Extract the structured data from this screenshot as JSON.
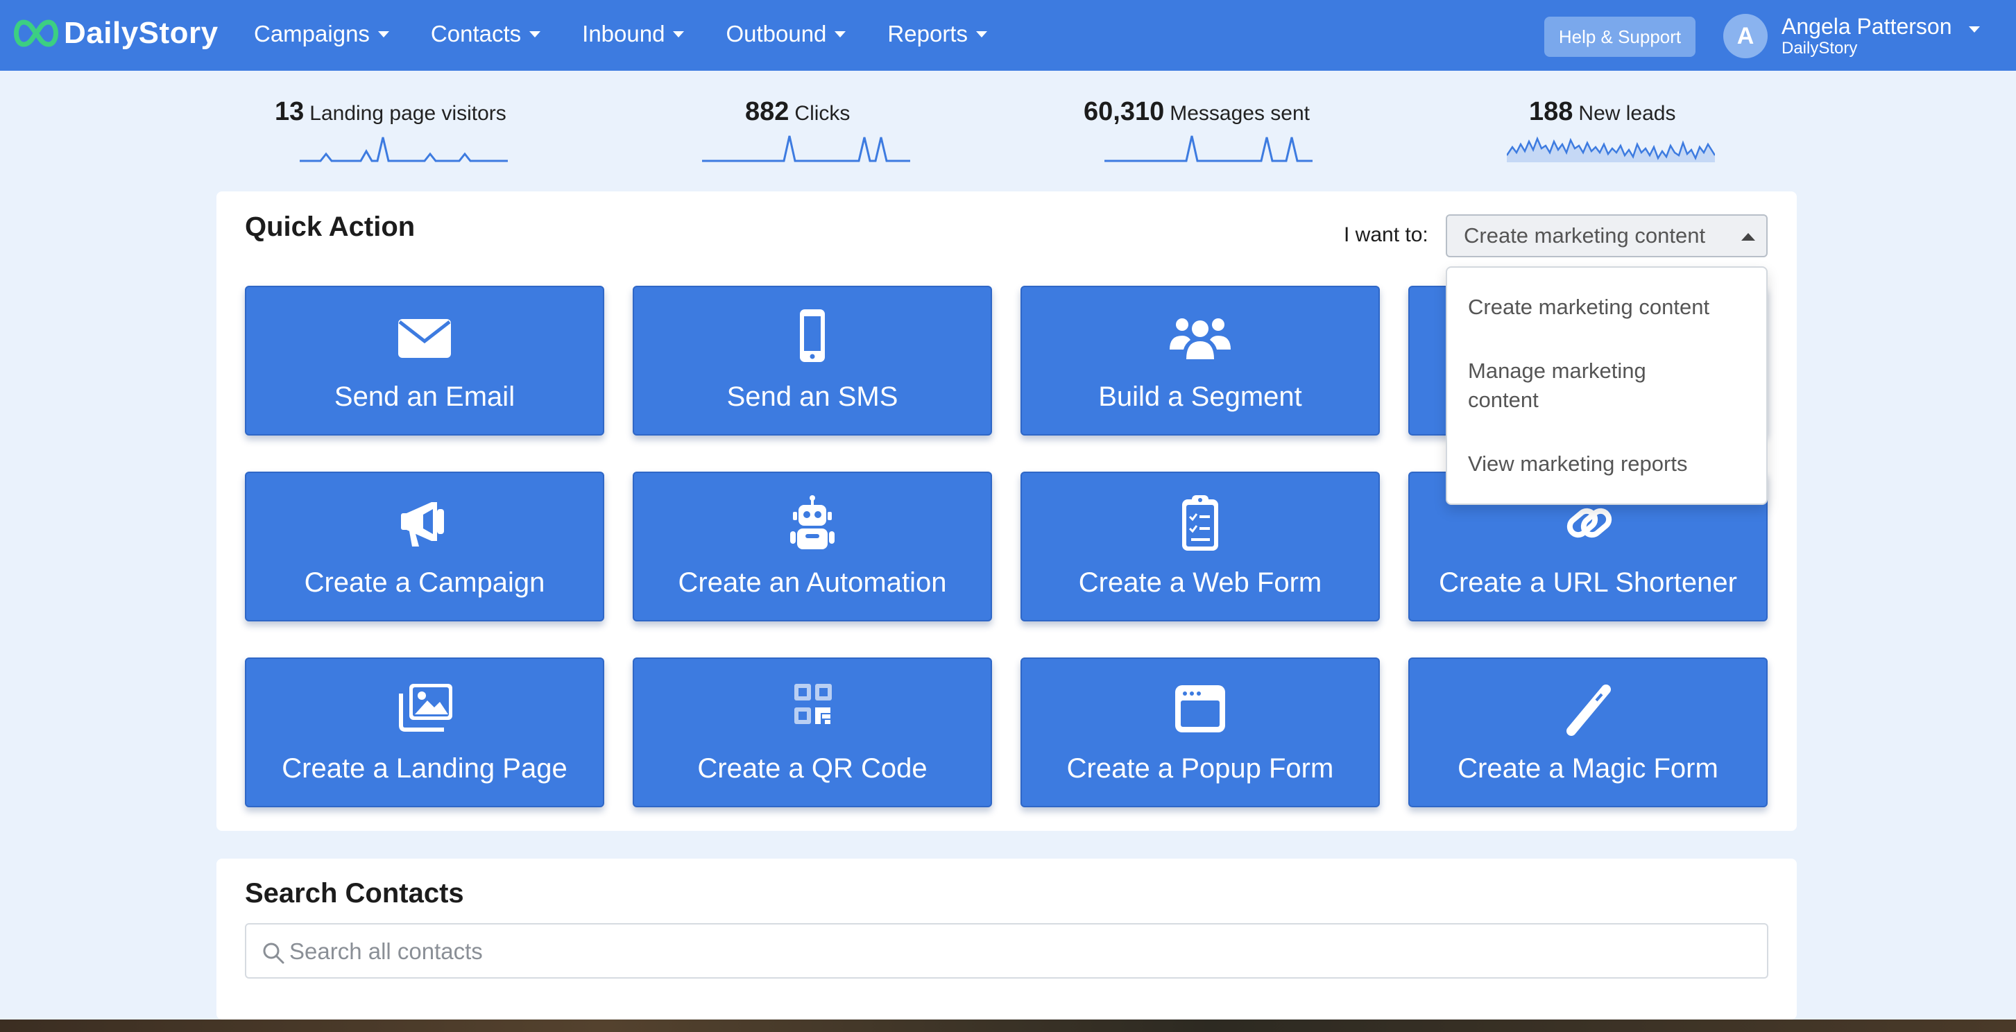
{
  "brand": {
    "name": "DailyStory",
    "accent": "#3d7be0",
    "logo_green": "#3ccf82"
  },
  "nav": {
    "items": [
      {
        "label": "Campaigns"
      },
      {
        "label": "Contacts"
      },
      {
        "label": "Inbound"
      },
      {
        "label": "Outbound"
      },
      {
        "label": "Reports"
      }
    ],
    "help_label": "Help & Support",
    "user": {
      "initial": "A",
      "name": "Angela Patterson",
      "org": "DailyStory"
    }
  },
  "stats": [
    {
      "value": "13",
      "label": "Landing page visitors"
    },
    {
      "value": "882",
      "label": "Clicks"
    },
    {
      "value": "60,310",
      "label": "Messages sent"
    },
    {
      "value": "188",
      "label": "New leads"
    }
  ],
  "quick_action": {
    "title": "Quick Action",
    "i_want_label": "I want to:",
    "selected": "Create marketing content",
    "options": [
      "Create marketing content",
      "Manage marketing content",
      "View marketing reports"
    ],
    "actions": [
      {
        "label": "Send an Email",
        "icon": "envelope-icon"
      },
      {
        "label": "Send an SMS",
        "icon": "mobile-phone-icon"
      },
      {
        "label": "Build a Segment",
        "icon": "users-group-icon"
      },
      {
        "label": "",
        "icon": "hidden-by-menu"
      },
      {
        "label": "Create a Campaign",
        "icon": "megaphone-icon"
      },
      {
        "label": "Create an Automation",
        "icon": "robot-icon"
      },
      {
        "label": "Create a Web Form",
        "icon": "clipboard-checklist-icon"
      },
      {
        "label": "Create a URL Shortener",
        "icon": "link-icon"
      },
      {
        "label": "Create a Landing Page",
        "icon": "images-icon"
      },
      {
        "label": "Create a QR Code",
        "icon": "qr-code-icon"
      },
      {
        "label": "Create a Popup Form",
        "icon": "browser-window-icon"
      },
      {
        "label": "Create a Magic Form",
        "icon": "magic-wand-icon"
      }
    ]
  },
  "search": {
    "title": "Search Contacts",
    "placeholder": "Search all contacts"
  }
}
